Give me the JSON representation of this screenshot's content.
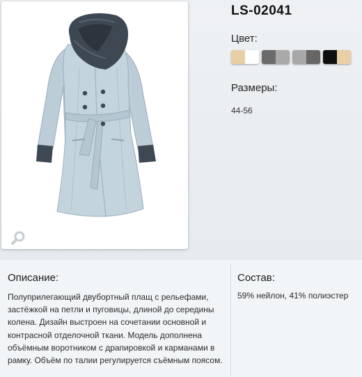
{
  "product": {
    "title": "LS-02041",
    "color_label": "Цвет:",
    "sizes_label": "Размеры:",
    "sizes_value": "44-56",
    "swatches": [
      {
        "name": "beige-white",
        "colors": [
          "#e9cfa6",
          "#ffffff"
        ]
      },
      {
        "name": "dark-grey-grey",
        "colors": [
          "#6b6b6b",
          "#a9a9a9"
        ]
      },
      {
        "name": "grey-dark-grey",
        "colors": [
          "#a8a8a8",
          "#666666"
        ]
      },
      {
        "name": "black-beige",
        "colors": [
          "#0f0f0f",
          "#e9cfa6"
        ]
      }
    ]
  },
  "description": {
    "heading": "Описание:",
    "text": "Полуприлегающий двубортный плащ с рельефами, застёжкой на петли и пуговицы, длиной до середины колена. Дизайн выстроен на сочетании основной и контрасной отделочной ткани. Модель дополнена объёмным воротником с драпировкой и карманами в рамку. Объём по талии регулируется съёмным поясом."
  },
  "composition": {
    "heading": "Состав:",
    "text": "59% нейлон, 41% полиэстер"
  },
  "icons": {
    "zoom": "magnifier-icon"
  },
  "colors": {
    "coat": "#c4d4dd",
    "contrast": "#3d4852",
    "background": "#e9eef2"
  }
}
